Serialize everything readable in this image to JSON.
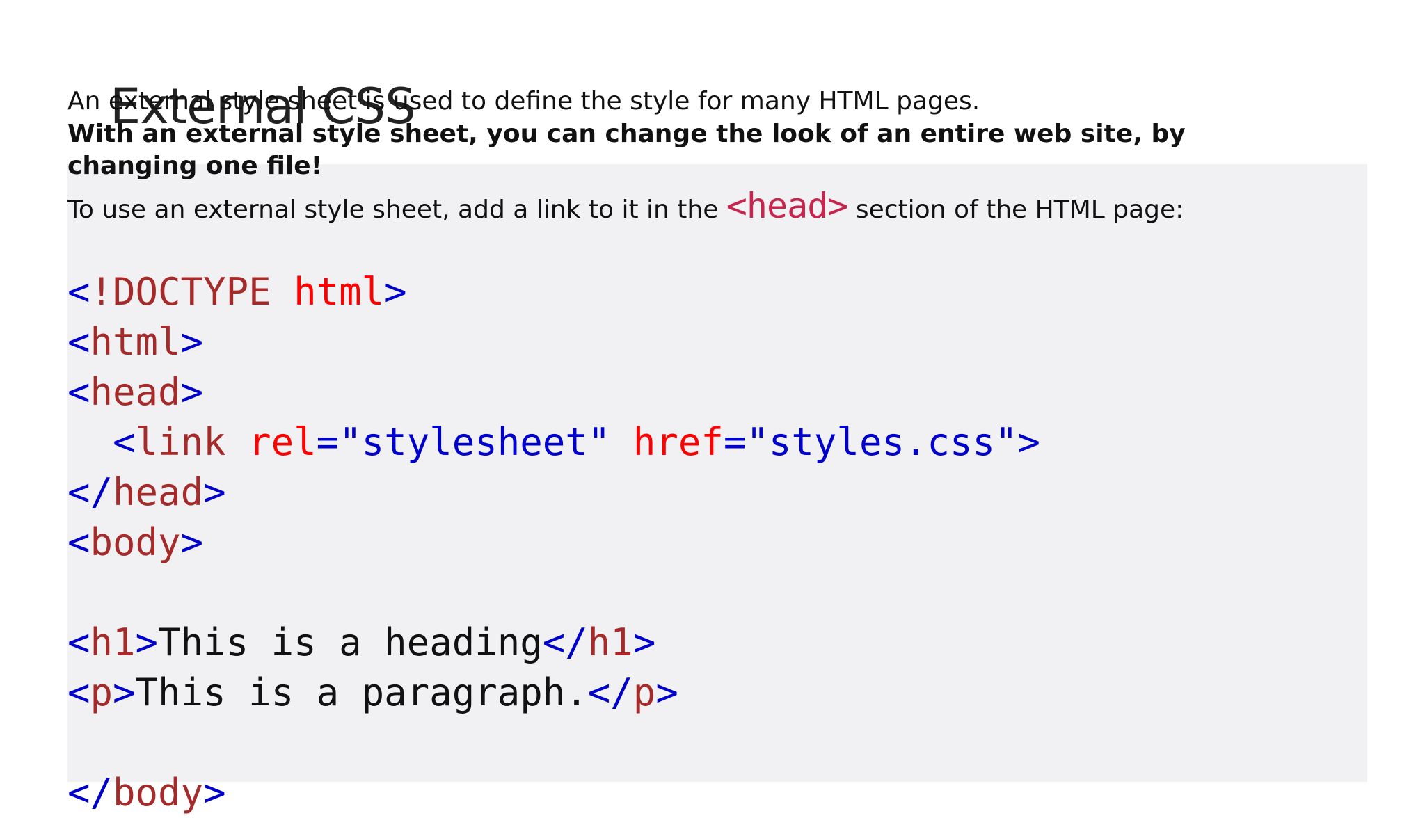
{
  "slide": {
    "title": "External CSS"
  },
  "intro": {
    "line1": "An external style sheet is used to define the style for many HTML pages.",
    "line2": "With an external style sheet, you can change the look of an entire web site, by changing one file!",
    "line3_before": "To use an external style sheet, add a link to it in the ",
    "line3_code": "<head>",
    "line3_after": " section of the HTML page:"
  },
  "code": {
    "doctype_open": "<",
    "doctype_kw": "!DOCTYPE",
    "doctype_space": " ",
    "doctype_attr": "html",
    "doctype_close": ">",
    "lt": "<",
    "gt": ">",
    "lt_slash": "</",
    "tag_html": "html",
    "tag_head": "head",
    "tag_link": "link",
    "tag_body": "body",
    "tag_h1": "h1",
    "tag_p": "p",
    "indent": "  ",
    "space": " ",
    "attr_rel": "rel",
    "attr_href": "href",
    "eq": "=",
    "val_rel": "\"stylesheet\"",
    "val_href": "\"styles.css\"",
    "text_h1": "This is a heading",
    "text_p": "This is a paragraph."
  },
  "colors": {
    "bracket": "#0000cd",
    "tag": "#a52a2a",
    "attribute": "#ff0000",
    "value": "#0000cd",
    "inline_code": "#c7254e",
    "code_background": "#f1f0f2"
  }
}
